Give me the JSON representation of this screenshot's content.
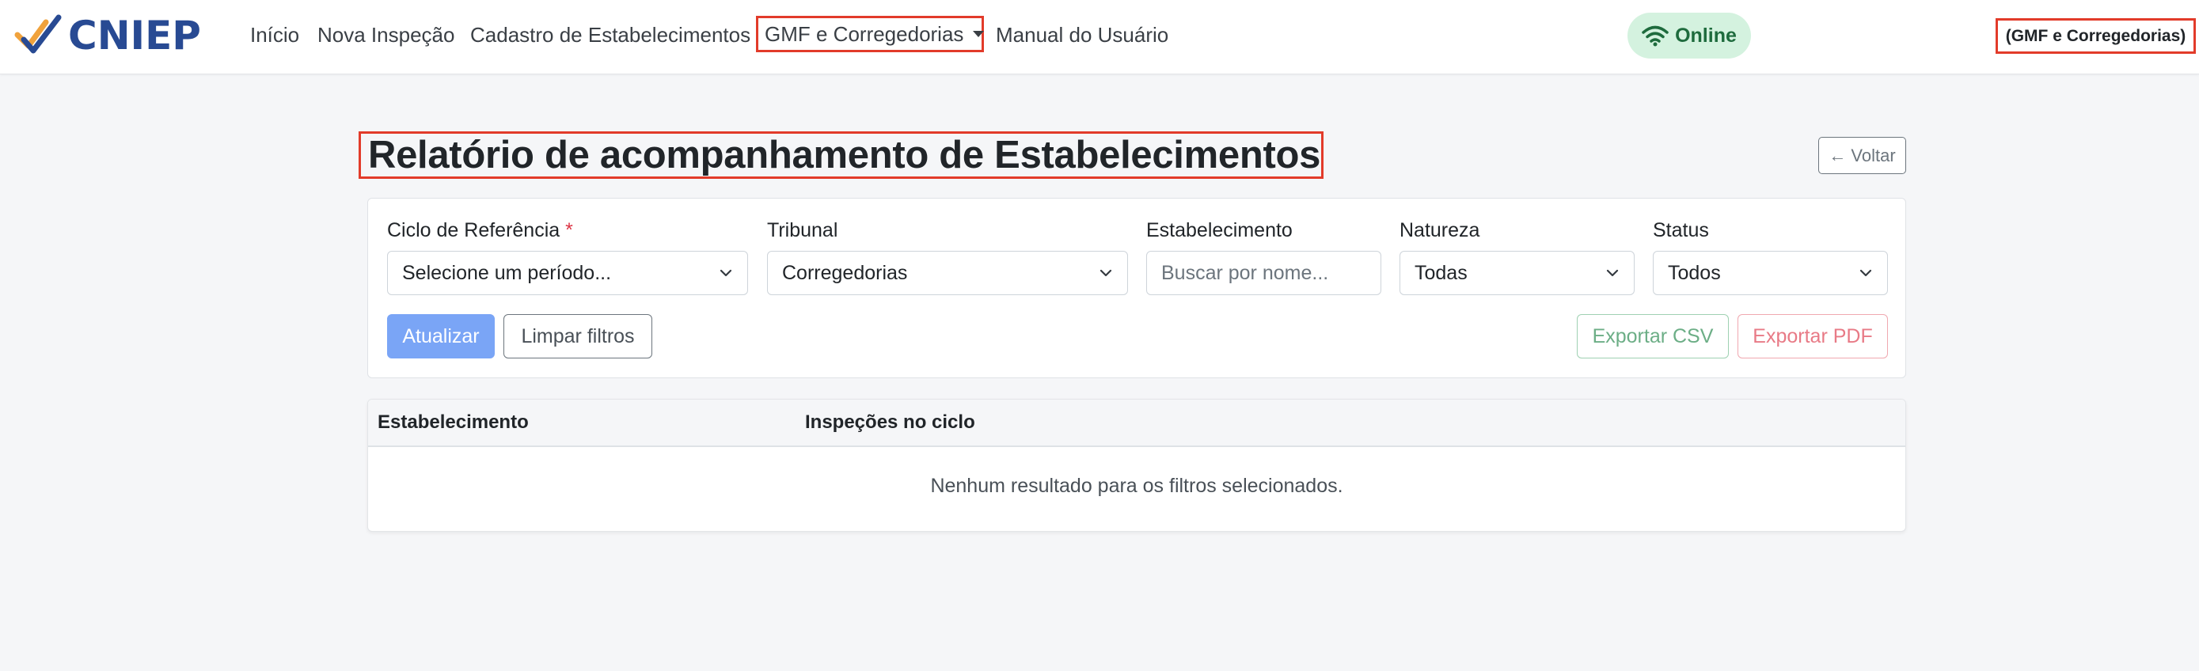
{
  "brand": {
    "name": "CNIEP"
  },
  "nav": {
    "items": [
      "Início",
      "Nova Inspeção",
      "Cadastro de Estabelecimentos"
    ],
    "dropdown_label": "GMF e Corregedorias",
    "manual": "Manual do Usuário"
  },
  "status": {
    "label": "Online",
    "color": "#1e6b3d"
  },
  "user": {
    "label": "(GMF e Corregedorias)"
  },
  "page": {
    "title": "Relatório de acompanhamento de Estabelecimentos",
    "back_label": "← Voltar"
  },
  "filters": {
    "ciclo": {
      "label": "Ciclo de Referência",
      "required_mark": "*",
      "value": "Selecione um período..."
    },
    "tribunal": {
      "label": "Tribunal",
      "value": "Corregedorias"
    },
    "estabelecimento": {
      "label": "Estabelecimento",
      "placeholder": "Buscar por nome..."
    },
    "natureza": {
      "label": "Natureza",
      "value": "Todas"
    },
    "status": {
      "label": "Status",
      "value": "Todos"
    }
  },
  "actions": {
    "update": "Atualizar",
    "clear": "Limpar filtros",
    "export_csv": "Exportar CSV",
    "export_pdf": "Exportar PDF"
  },
  "table": {
    "columns": [
      "Estabelecimento",
      "Inspeções no ciclo"
    ],
    "empty_message": "Nenhum resultado para os filtros selecionados."
  },
  "colors": {
    "brand": "#284a93",
    "accent_highlight": "#e23b2a",
    "primary": "#7aa5f6"
  }
}
